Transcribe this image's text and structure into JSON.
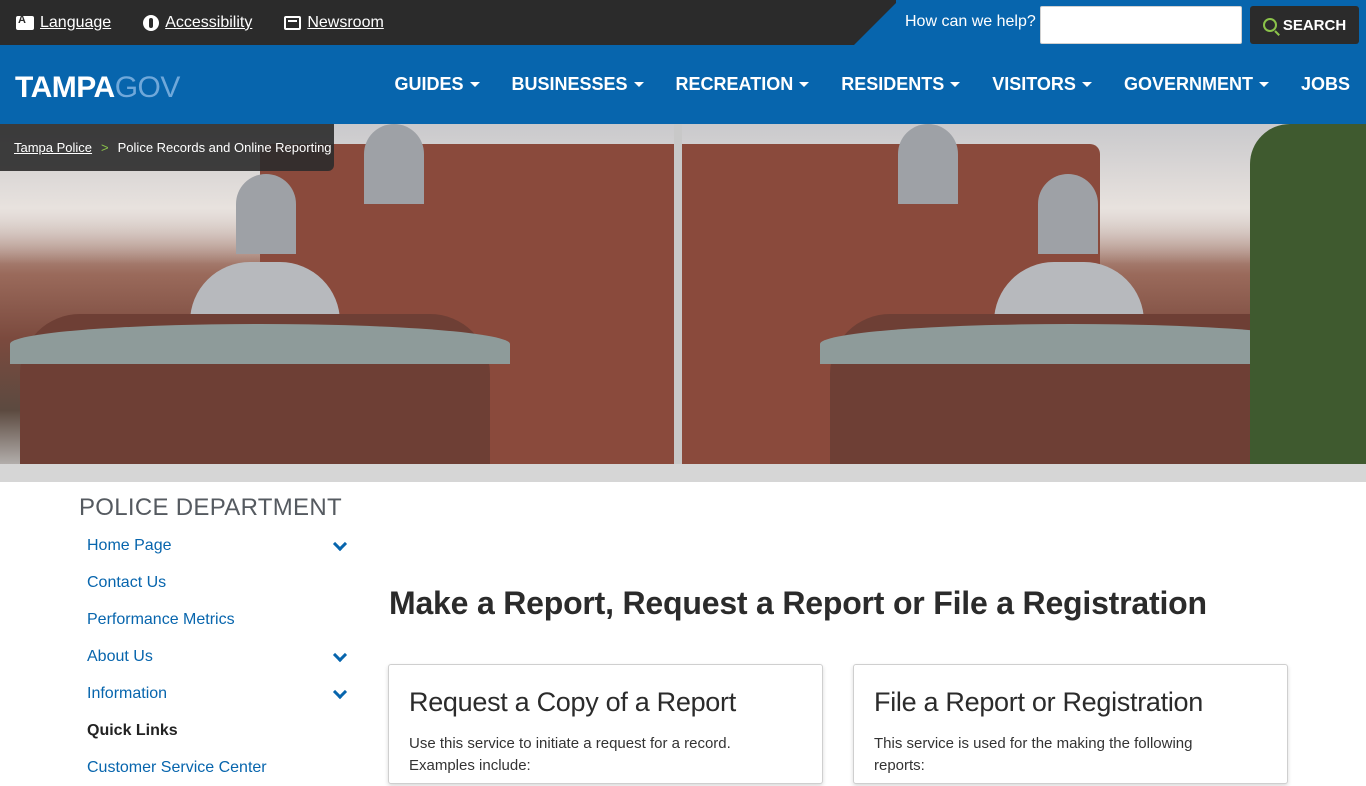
{
  "utility": {
    "language": "Language",
    "accessibility": "Accessibility",
    "newsroom": "Newsroom",
    "help_label": "How can we help?",
    "search_value": "",
    "search_button": "SEARCH"
  },
  "logo": {
    "part1": "TAMPA",
    "part2": "GOV"
  },
  "nav": {
    "items": [
      {
        "label": "GUIDES",
        "dropdown": true
      },
      {
        "label": "BUSINESSES",
        "dropdown": true
      },
      {
        "label": "RECREATION",
        "dropdown": true
      },
      {
        "label": "RESIDENTS",
        "dropdown": true
      },
      {
        "label": "VISITORS",
        "dropdown": true
      },
      {
        "label": "GOVERNMENT",
        "dropdown": true
      },
      {
        "label": "JOBS",
        "dropdown": false
      }
    ]
  },
  "breadcrumb": {
    "parent": "Tampa Police",
    "separator": ">",
    "current": "Police Records and Online Reporting"
  },
  "sidebar": {
    "title": "POLICE DEPARTMENT",
    "items": [
      {
        "label": "Home Page",
        "expandable": true
      },
      {
        "label": "Contact Us",
        "expandable": false
      },
      {
        "label": "Performance Metrics",
        "expandable": false
      },
      {
        "label": "About Us",
        "expandable": true
      },
      {
        "label": "Information",
        "expandable": true
      },
      {
        "label": "Quick Links",
        "expandable": false,
        "active": true
      },
      {
        "label": "Customer Service Center",
        "expandable": false
      }
    ]
  },
  "main": {
    "title": "Make a Report, Request a Report or File a Registration",
    "cards": [
      {
        "title": "Request a Copy of a Report",
        "text": "Use this service to initiate a request for a record. Examples include:"
      },
      {
        "title": "File a Report or Registration",
        "text": "This service is used for the making the following reports:"
      }
    ]
  },
  "colors": {
    "brand_blue": "#0765ad",
    "dark_bar": "#2b2b2b",
    "accent_green": "#8bc34a"
  }
}
